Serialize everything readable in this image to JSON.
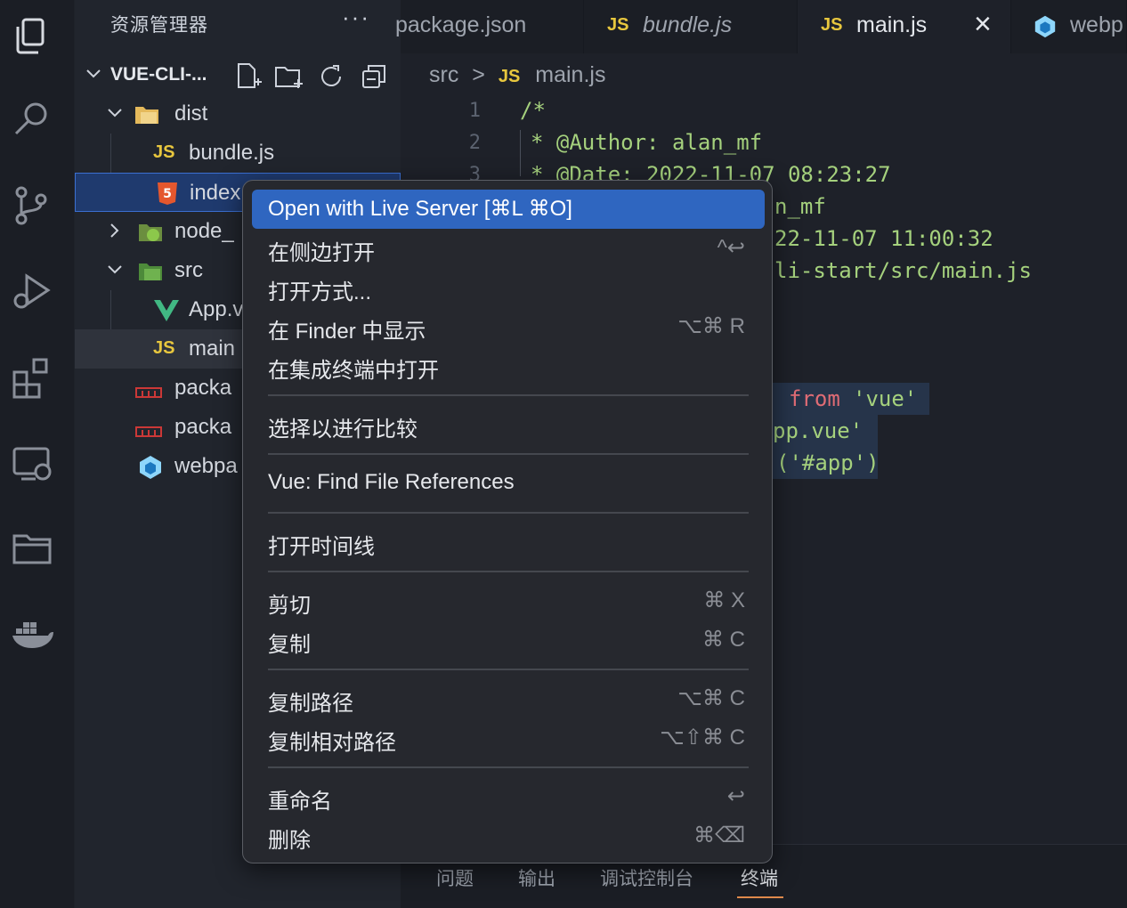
{
  "explorer": {
    "title": "资源管理器",
    "more": "···",
    "root_label": "VUE-CLI-...",
    "tree": [
      {
        "label": "dist",
        "type": "folder-open"
      },
      {
        "label": "bundle.js",
        "type": "js"
      },
      {
        "label": "index",
        "type": "html"
      },
      {
        "label": "node_",
        "type": "folder-closed"
      },
      {
        "label": "src",
        "type": "folder-open"
      },
      {
        "label": "App.v",
        "type": "vue"
      },
      {
        "label": "main",
        "type": "js"
      },
      {
        "label": "packa",
        "type": "json"
      },
      {
        "label": "packa",
        "type": "json"
      },
      {
        "label": "webpa",
        "type": "webpack"
      }
    ]
  },
  "tabs": [
    {
      "label": "package.json"
    },
    {
      "label": "bundle.js",
      "icon": "JS"
    },
    {
      "label": "main.js",
      "icon": "JS",
      "close": "×"
    },
    {
      "label": "webp"
    }
  ],
  "breadcrumb": {
    "folder": "src",
    "sep": ">",
    "icon": "JS",
    "file": "main.js"
  },
  "code": {
    "line_numbers": [
      "1",
      "2",
      "3"
    ],
    "lines": [
      "/*",
      "* @Author: alan_mf",
      "* @Date: 2022-11-07 08:23:27",
      "n_mf",
      "22-11-07 11:00:32",
      "li-start/src/main.js"
    ],
    "import_from": "from",
    "import_vue": "'vue'",
    "import_app": "pp.vue'",
    "mount": "('#app')"
  },
  "context_menu": {
    "items": [
      {
        "label": "Open with Live Server [⌘L ⌘O]",
        "shortcut": ""
      },
      {
        "label": "在侧边打开",
        "shortcut": "^↩"
      },
      {
        "label": "打开方式...",
        "shortcut": ""
      },
      {
        "label": "在 Finder 中显示",
        "shortcut": "⌥⌘ R"
      },
      {
        "label": "在集成终端中打开",
        "shortcut": ""
      },
      {
        "label": "选择以进行比较",
        "shortcut": ""
      },
      {
        "label": "Vue: Find File References",
        "shortcut": ""
      },
      {
        "label": "打开时间线",
        "shortcut": ""
      },
      {
        "label": "剪切",
        "shortcut": "⌘ X"
      },
      {
        "label": "复制",
        "shortcut": "⌘ C"
      },
      {
        "label": "复制路径",
        "shortcut": "⌥⌘ C"
      },
      {
        "label": "复制相对路径",
        "shortcut": "⌥⇧⌘ C"
      },
      {
        "label": "重命名",
        "shortcut": "↩"
      },
      {
        "label": "删除",
        "shortcut": "⌘⌫"
      }
    ]
  },
  "panel": {
    "tabs": [
      "问题",
      "输出",
      "调试控制台",
      "终端"
    ],
    "active": "终端"
  },
  "colors": {
    "accent": "#2f66c0",
    "js": "#e8c73e",
    "comment": "#a5d17d",
    "active_tab_underline": "#e08a4c"
  }
}
